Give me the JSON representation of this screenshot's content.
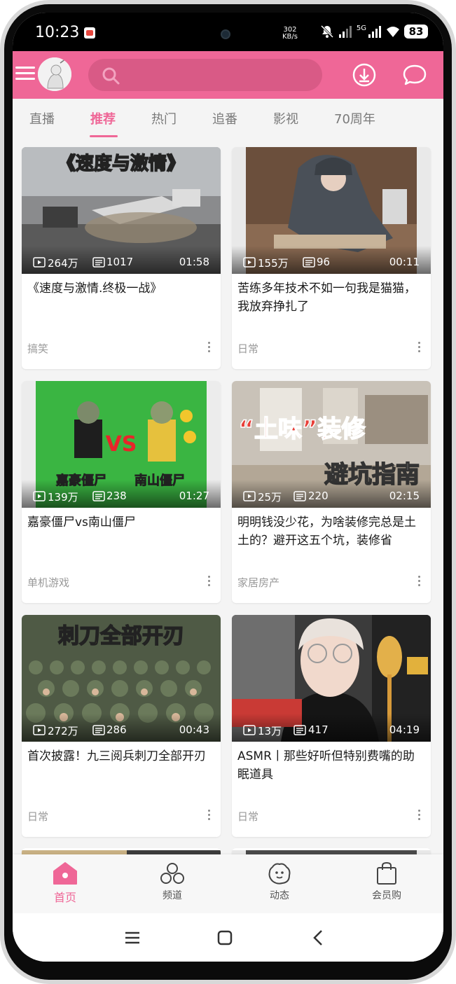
{
  "status_bar": {
    "time": "10:23",
    "speed_value": "302",
    "speed_unit": "KB/s",
    "network": "5G",
    "battery": "83"
  },
  "header": {
    "search_placeholder": ""
  },
  "tabs": [
    {
      "label": "直播"
    },
    {
      "label": "推荐"
    },
    {
      "label": "热门"
    },
    {
      "label": "追番"
    },
    {
      "label": "影视"
    },
    {
      "label": "70周年"
    }
  ],
  "active_tab": "推荐",
  "videos": [
    {
      "title": "《速度与激情.终极一战》",
      "views": "264万",
      "danmaku": "1017",
      "duration": "01:58",
      "category": "搞笑",
      "thumb_text": "《速度与激情》"
    },
    {
      "title": "苦练多年技术不如一句我是猫猫，我放弃挣扎了",
      "views": "155万",
      "danmaku": "96",
      "duration": "00:11",
      "category": "日常",
      "thumb_text": ""
    },
    {
      "title": "嘉豪僵尸vs南山僵尸",
      "views": "139万",
      "danmaku": "238",
      "duration": "01:27",
      "category": "单机游戏",
      "thumb_text": "VS",
      "thumb_left": "嘉豪僵尸",
      "thumb_right": "南山僵尸"
    },
    {
      "title": "明明钱没少花，为啥装修完总是土土的？避开这五个坑，装修省",
      "views": "25万",
      "danmaku": "220",
      "duration": "02:15",
      "category": "家居房产",
      "thumb_text": "“土味”装修",
      "thumb_text2": "避坑指南"
    },
    {
      "title": "首次披露！九三阅兵刺刀全部开刃",
      "views": "272万",
      "danmaku": "286",
      "duration": "00:43",
      "category": "日常",
      "thumb_text": "刺刀全部开刃"
    },
    {
      "title": "ASMR丨那些好听但特别费嘴的助眠道具",
      "views": "13万",
      "danmaku": "417",
      "duration": "04:19",
      "category": "日常",
      "thumb_text": ""
    }
  ],
  "bottom_nav": [
    {
      "label": "首页",
      "icon": "home-icon"
    },
    {
      "label": "频道",
      "icon": "channels-icon"
    },
    {
      "label": "动态",
      "icon": "dynamic-icon"
    },
    {
      "label": "会员购",
      "icon": "shopping-bag-icon"
    }
  ],
  "colors": {
    "accent": "#ef6797",
    "search_bg": "#d95a86",
    "background": "#f4f4f4"
  }
}
